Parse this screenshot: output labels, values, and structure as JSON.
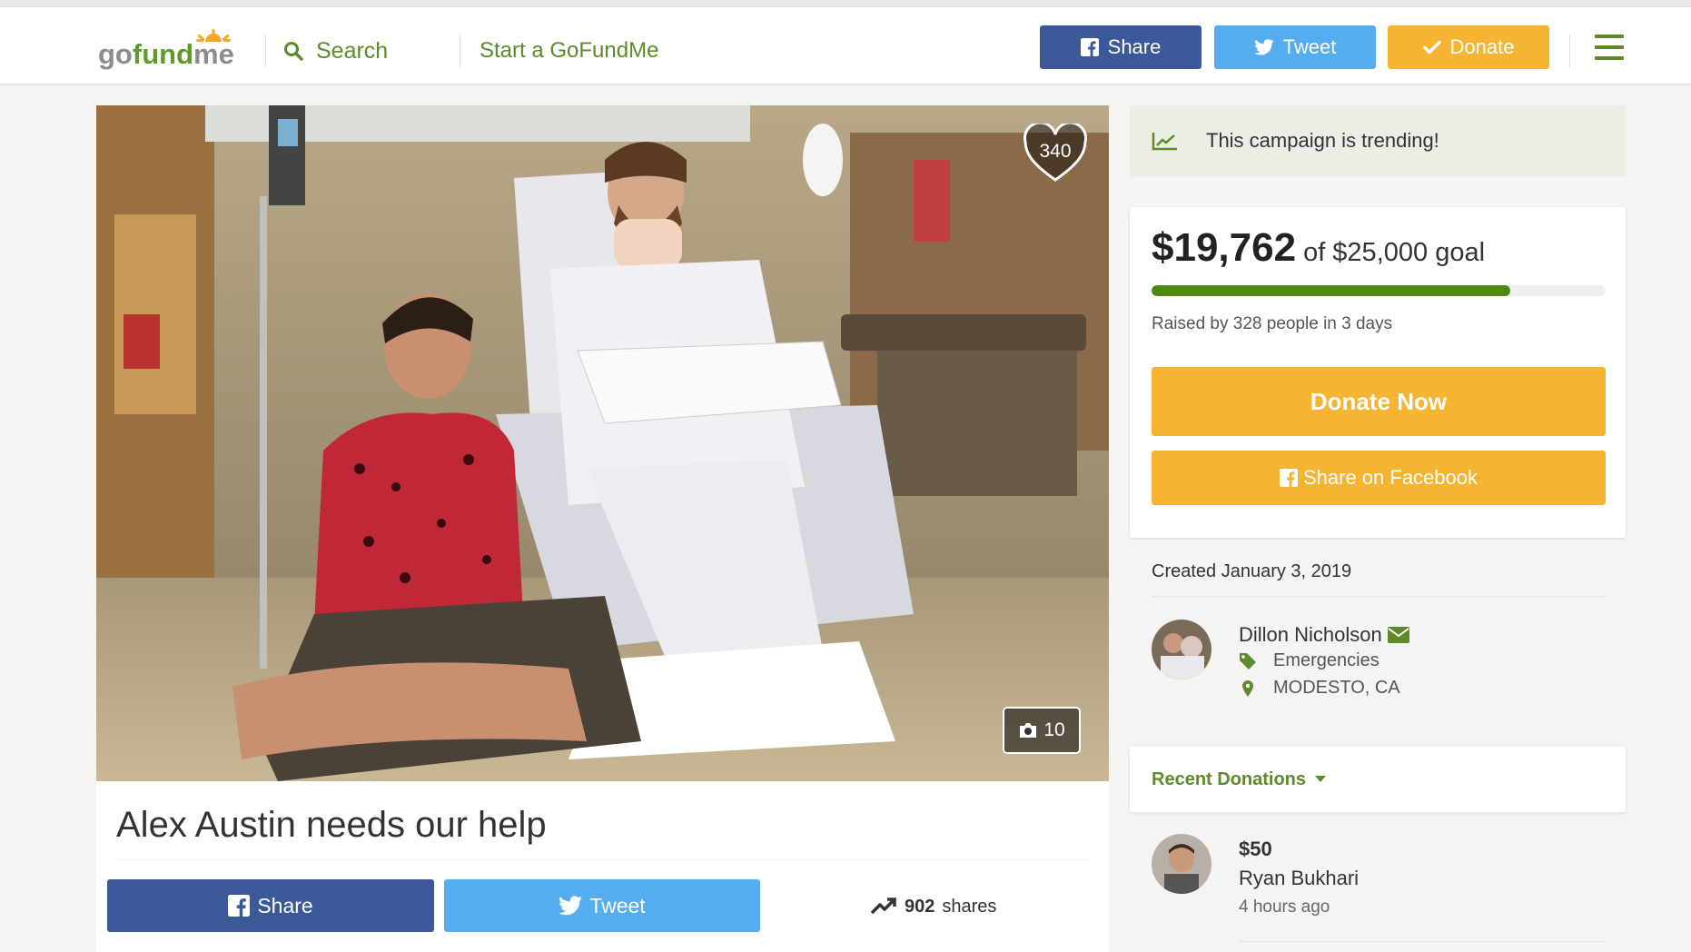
{
  "header": {
    "logo_text_go": "go",
    "logo_text_fund": "fund",
    "logo_text_me": "me",
    "search_label": "Search",
    "start_label": "Start a GoFundMe",
    "share_label": "Share",
    "tweet_label": "Tweet",
    "donate_label": "Donate"
  },
  "photo": {
    "hearts": "340",
    "photo_count": "10"
  },
  "story": {
    "title": "Alex Austin needs our help",
    "share_label": "Share",
    "tweet_label": "Tweet",
    "shares_count": "902",
    "shares_label": "shares"
  },
  "sidebar": {
    "trending_text": "This campaign is trending!",
    "raised_amount": "$19,762",
    "goal_text": "of $25,000 goal",
    "progress_fraction": 0.79,
    "raised_by": "Raised by 328 people in 3 days",
    "donate_now": "Donate Now",
    "share_facebook": "Share on Facebook",
    "created": "Created January 3, 2019",
    "organizer_name": "Dillon Nicholson",
    "category": "Emergencies",
    "location": "MODESTO, CA",
    "recent_label": "Recent Donations",
    "donation": {
      "amount": "$50",
      "name": "Ryan Bukhari",
      "time": "4 hours ago"
    }
  },
  "colors": {
    "brand_green": "#5e8a2a",
    "facebook_blue": "#3b5998",
    "twitter_blue": "#55acee",
    "donate_orange": "#f5b431",
    "progress_green": "#4f8a10"
  }
}
